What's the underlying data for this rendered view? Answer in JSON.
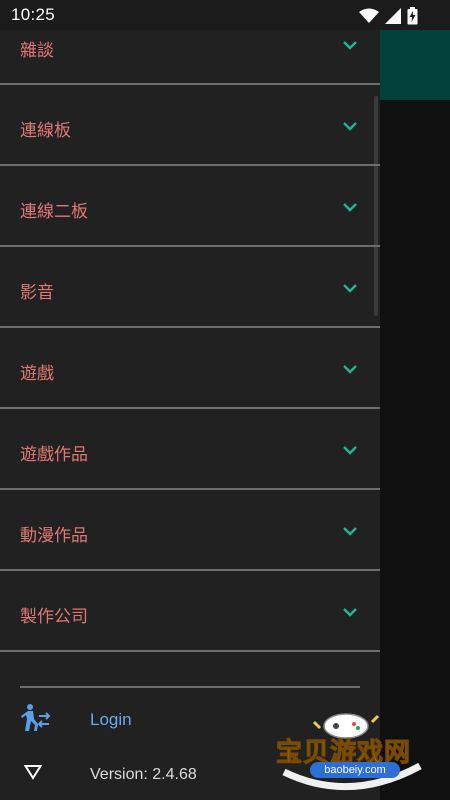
{
  "status_bar": {
    "time": "10:25"
  },
  "categories": [
    {
      "label": "雜談"
    },
    {
      "label": "連線板"
    },
    {
      "label": "連線二板"
    },
    {
      "label": "影音"
    },
    {
      "label": "遊戲"
    },
    {
      "label": "遊戲作品"
    },
    {
      "label": "動漫作品"
    },
    {
      "label": "製作公司"
    }
  ],
  "footer": {
    "login_label": "Login",
    "version_label": "Version: 2.4.68"
  },
  "watermark": {
    "title": "宝贝游戏网",
    "url": "baobeiy.com"
  },
  "colors": {
    "category_text": "#e07874",
    "chevron": "#1fb59a",
    "login_text": "#6aa9e8",
    "drawer_bg": "#212121",
    "toolbar_bg": "#00423a"
  },
  "icons": {
    "wifi": "wifi-icon",
    "signal": "signal-icon",
    "battery": "battery-charging-icon",
    "chevron": "chevron-down-icon",
    "login": "person-walking-icon",
    "version": "triangle-down-icon"
  }
}
